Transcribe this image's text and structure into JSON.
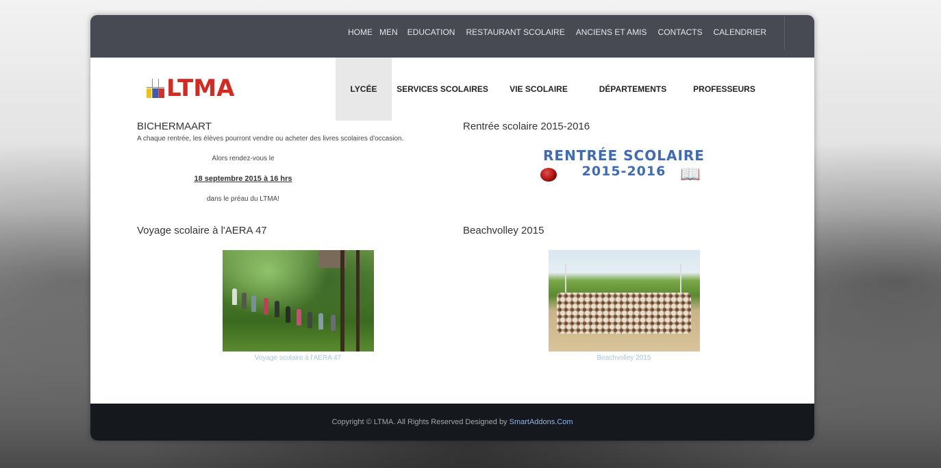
{
  "topnav": {
    "items": [
      {
        "label": "HOME"
      },
      {
        "label": "MEN"
      },
      {
        "label": "EDUCATION"
      },
      {
        "label": "RESTAURANT SCOLAIRE"
      },
      {
        "label": "ANCIENS ET AMIS"
      },
      {
        "label": "CONTACTS"
      },
      {
        "label": "CALENDRIER"
      }
    ]
  },
  "logo": {
    "text": "LTMA"
  },
  "mainnav": {
    "items": [
      {
        "label": "LYCÉE",
        "active": true
      },
      {
        "label": "SERVICES SCOLAIRES"
      },
      {
        "label": "VIE SCOLAIRE"
      },
      {
        "label": "DÉPARTEMENTS"
      },
      {
        "label": "PROFESSEURS"
      }
    ]
  },
  "articles": {
    "bichermaart": {
      "title": "BICHERMAART",
      "intro": "A chaque rentrée, les élèves pourront vendre ou acheter des livres scolaires d'occasion.",
      "line2": "Alors rendez-vous le",
      "date": "18 septembre 2015 à 16 hrs",
      "line4": "dans le préau du LTMA!"
    },
    "rentree": {
      "title": "Rentrée scolaire 2015-2016",
      "image_line1": "RENTRÉE SCOLAIRE",
      "image_line2": "2015-2016"
    },
    "voyage": {
      "title": "Voyage scolaire à l'AERA 47",
      "caption": "Voyage scolaire à l'AERA 47"
    },
    "beachvolley": {
      "title": "Beachvolley 2015",
      "caption": "Beachvolley 2015"
    }
  },
  "footer": {
    "text": "Copyright © LTMA. All Rights Reserved Designed by ",
    "link": "SmartAddons.Com"
  },
  "colors": {
    "topbar": "#474a53",
    "footer": "#15181d",
    "logo_red": "#d42a22",
    "rentree_blue": "#3d6bb8",
    "caption_blue": "#a7c6e0",
    "footer_link": "#8cb6f0"
  }
}
